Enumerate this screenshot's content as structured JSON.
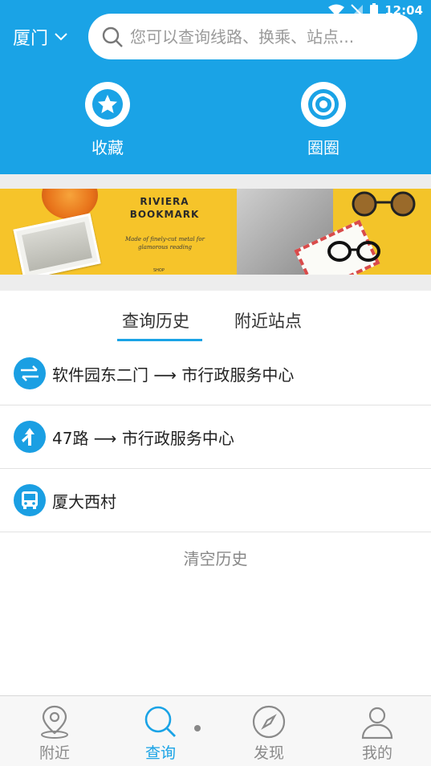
{
  "status_bar": {
    "time": "12:04"
  },
  "header": {
    "city": "厦门",
    "search_placeholder": "您可以查询线路、换乘、站点...",
    "quick_actions": [
      {
        "label": "收藏",
        "icon": "star-icon"
      },
      {
        "label": "圈圈",
        "icon": "chrome-icon"
      }
    ]
  },
  "banner": {
    "title": "RIVIERA BOOKMARK",
    "subtitle": "Made of finely-cut metal for glamorous reading",
    "shop": "SHOP"
  },
  "tabs": [
    {
      "label": "查询历史",
      "active": true
    },
    {
      "label": "附近站点",
      "active": false
    }
  ],
  "history": [
    {
      "type": "transfer",
      "icon": "transfer-arrows-icon",
      "text": "软件园东二门 ⟶ 市行政服务中心"
    },
    {
      "type": "route",
      "icon": "route-direction-icon",
      "text": "47路 ⟶ 市行政服务中心"
    },
    {
      "type": "station",
      "icon": "bus-icon",
      "text": "厦大西村"
    }
  ],
  "clear_history": "清空历史",
  "bottom_nav": [
    {
      "label": "附近",
      "icon": "location-pin-icon",
      "active": false
    },
    {
      "label": "查询",
      "icon": "search-icon",
      "active": true
    },
    {
      "label": "发现",
      "icon": "compass-icon",
      "active": false
    },
    {
      "label": "我的",
      "icon": "user-icon",
      "active": false
    }
  ],
  "colors": {
    "primary": "#1aa3e6",
    "banner_yellow": "#f6c42a"
  }
}
